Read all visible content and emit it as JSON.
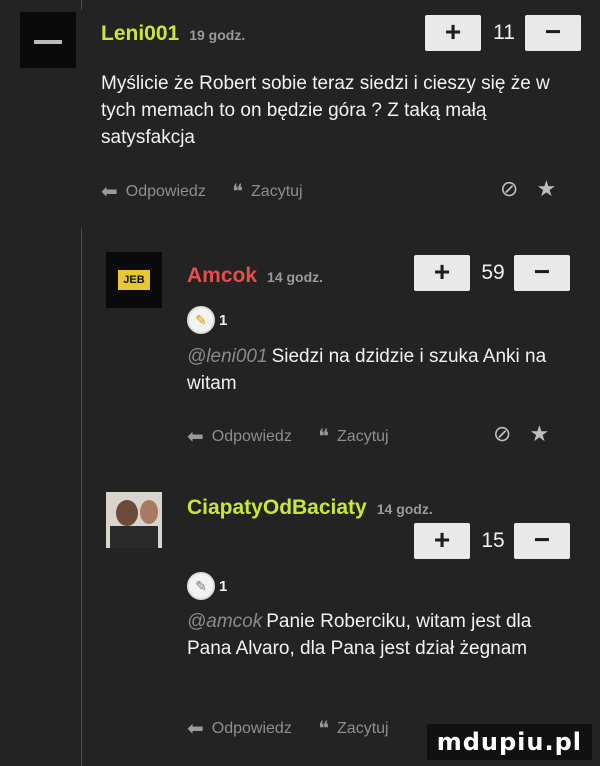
{
  "comments": [
    {
      "username": "Leni001",
      "time": "19 godz.",
      "votes": "11",
      "plus": "+",
      "minus": "−",
      "color": "#c6e83b",
      "mention": "",
      "text": "Myślicie że Robert sobie teraz siedzi i cieszy się że w tych memach to on będzie góra ? Z taką małą satysfakcja",
      "badge_count": ""
    },
    {
      "username": "Amcok",
      "time": "14 godz.",
      "votes": "59",
      "plus": "+",
      "minus": "−",
      "color": "#e84c4c",
      "mention": "@leni001",
      "text": "Siedzi na dzidzie i szuka Anki na witam",
      "badge_count": "1",
      "avatar_text": "JEB"
    },
    {
      "username": "CiapatyOdBaciaty",
      "time": "14 godz.",
      "votes": "15",
      "plus": "+",
      "minus": "−",
      "color": "#c6e83b",
      "mention": "@amcok",
      "text": "Panie Roberciku, witam jest dla Pana Alvaro, dla Pana jest dział żegnam",
      "badge_count": "1"
    }
  ],
  "actions": {
    "reply_label": "Odpowiedz",
    "quote_label": "Zacytuj"
  },
  "watermark": "mdupiu.pl"
}
